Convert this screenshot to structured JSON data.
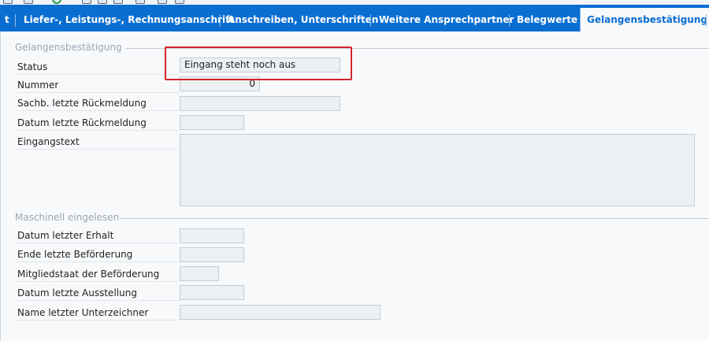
{
  "tabs": [
    {
      "label": "t",
      "active": false
    },
    {
      "label": "Liefer-, Leistungs-, Rechnungsanschrift",
      "active": false
    },
    {
      "label": "Anschreiben, Unterschriften",
      "active": false
    },
    {
      "label": "Weitere Ansprechpartner",
      "active": false
    },
    {
      "label": "Belegwerte",
      "active": false
    },
    {
      "label": "Gelangensbestätigung",
      "active": true
    }
  ],
  "group1": {
    "title": "Gelangensbestätigung",
    "status_label": "Status",
    "status_value": "Eingang steht noch aus",
    "nummer_label": "Nummer",
    "nummer_value": "0",
    "sachb_label": "Sachb. letzte Rückmeldung",
    "sachb_value": "",
    "datum_rm_label": "Datum letzte Rückmeldung",
    "datum_rm_value": "",
    "eingangstext_label": "Eingangstext",
    "eingangstext_value": ""
  },
  "group2": {
    "title": "Maschinell eingelesen",
    "erhalt_label": "Datum letzter Erhalt",
    "erhalt_value": "",
    "befoerderung_label": "Ende letzte Beförderung",
    "befoerderung_value": "",
    "mitgliedstaat_label": "Mitgliedstaat der Beförderung",
    "mitgliedstaat_value": "",
    "ausstellung_label": "Datum letzte Ausstellung",
    "ausstellung_value": "",
    "unterzeichner_label": "Name letzter Unterzeichner",
    "unterzeichner_value": ""
  },
  "colors": {
    "tab_bar": "#0a6ed1",
    "highlight": "#d0262d"
  }
}
